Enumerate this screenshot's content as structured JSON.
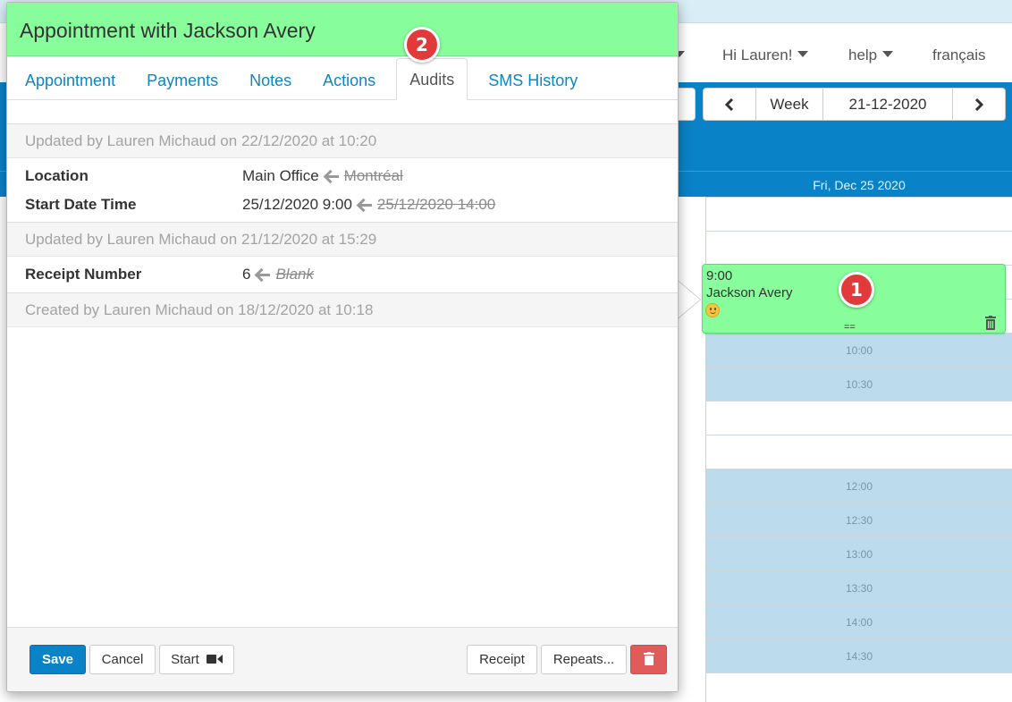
{
  "modal": {
    "title": "Appointment with Jackson Avery",
    "tabs": [
      {
        "label": "Appointment"
      },
      {
        "label": "Payments"
      },
      {
        "label": "Notes"
      },
      {
        "label": "Actions"
      },
      {
        "label": "Audits",
        "active": true
      },
      {
        "label": "SMS History"
      }
    ],
    "audits": [
      {
        "header": "Updated by Lauren Michaud on 22/12/2020 at 10:20",
        "changes": [
          {
            "field": "Location",
            "new": "Main Office",
            "old": "Montréal"
          },
          {
            "field": "Start Date Time",
            "new": "25/12/2020 9:00",
            "old": "25/12/2020 14:00"
          }
        ]
      },
      {
        "header": "Updated by Lauren Michaud on 21/12/2020 at 15:29",
        "changes": [
          {
            "field": "Receipt Number",
            "new": "6",
            "old": "Blank"
          }
        ]
      },
      {
        "header": "Created by Lauren Michaud on 18/12/2020 at 10:18",
        "changes": []
      }
    ],
    "footer": {
      "save": "Save",
      "cancel": "Cancel",
      "start": "Start",
      "receipt": "Receipt",
      "repeats": "Repeats..."
    }
  },
  "topnav": {
    "greeting": "Hi Lauren!",
    "help": "help",
    "language": "français"
  },
  "calendar": {
    "view": "Week",
    "date": "21-12-2020",
    "day_header": "Fri, Dec 25 2020",
    "times": [
      "10:00",
      "10:30",
      "12:00",
      "12:30",
      "13:00",
      "13:30",
      "14:00",
      "14:30"
    ],
    "event": {
      "time": "9:00",
      "name": "Jackson Avery",
      "handle": "=="
    }
  },
  "callouts": [
    "1",
    "2"
  ],
  "colors": {
    "modal_header": "#88fd9b",
    "primary": "#0a82c8",
    "danger": "#e05c5a",
    "callout": "#e23a3a"
  }
}
